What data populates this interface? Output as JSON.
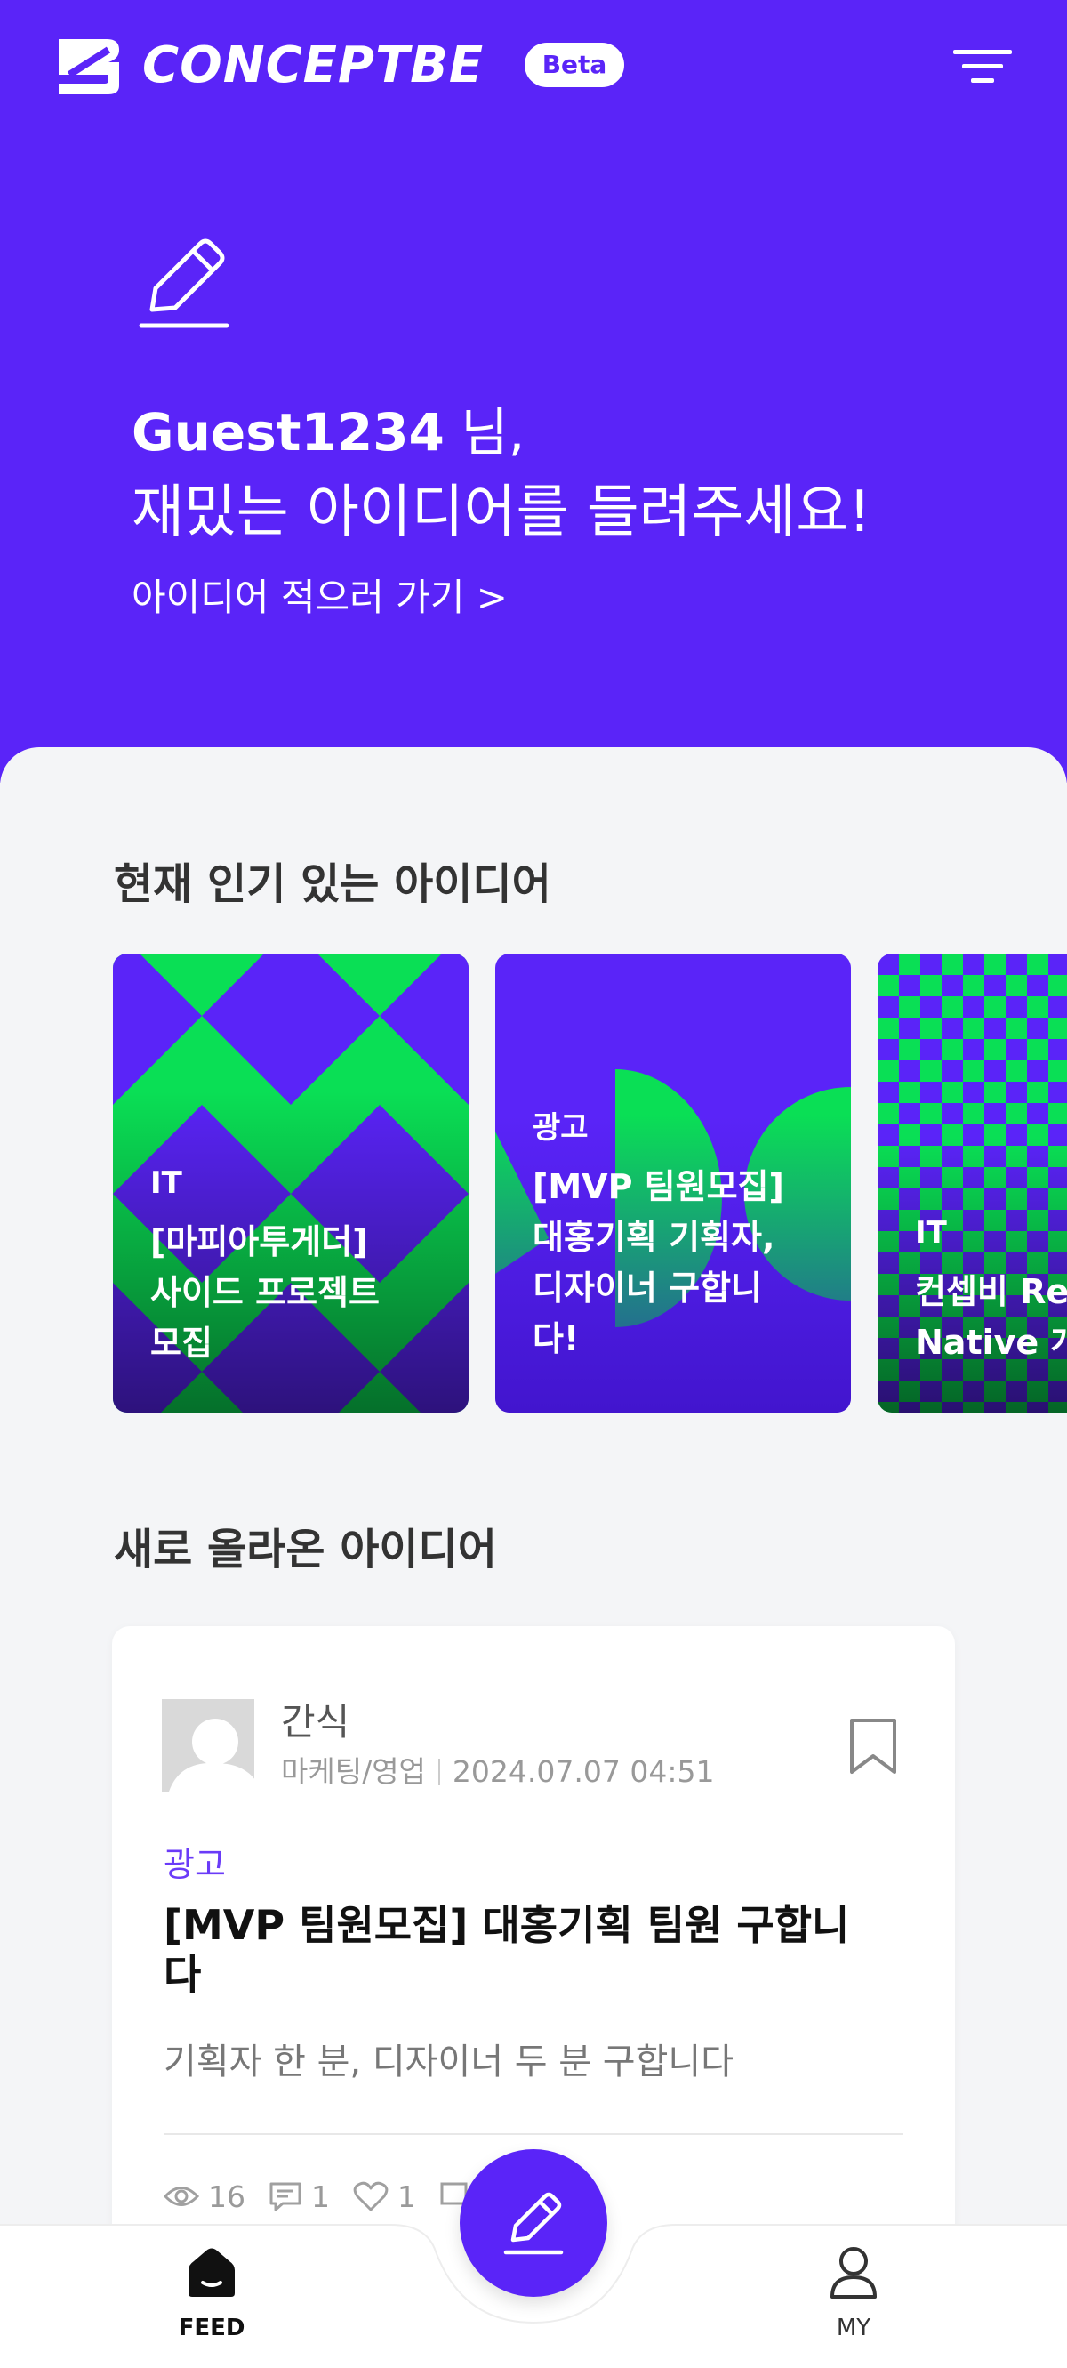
{
  "header": {
    "brand_name": "CONCEPTBE",
    "beta_badge": "Beta",
    "icons": {
      "logo": "brand-logo-icon",
      "menu": "filter-menu-icon"
    }
  },
  "hero": {
    "icon": "pencil-icon",
    "username": "Guest1234",
    "honorific": " 님,",
    "subtitle": "재밌는 아이디어를 들려주세요!",
    "link_text": "아이디어 적으러 가기 >"
  },
  "popular": {
    "title": "현재 인기 있는 아이디어",
    "cards": [
      {
        "category": "IT",
        "title": "[마피아투게더]\n사이드 프로젝트\n모집",
        "pattern": "diamond"
      },
      {
        "category": "광고",
        "title": "[MVP 팀원모집]\n대홍기획 기획자,\n디자이너 구합니\n다!",
        "pattern": "semicircle"
      },
      {
        "category": "IT",
        "title": "컨셉비 Re\nNative 개",
        "pattern": "checker"
      }
    ]
  },
  "new_ideas": {
    "title": "새로 올라온 아이디어",
    "post": {
      "author": "간식",
      "department": "마케팅/영업",
      "datetime": "2024.07.07 04:51",
      "category": "광고",
      "title": "[MVP 팀원모집] 대홍기획 팀원 구합니\n다",
      "body": "기획자 한 분, 디자이너 두 분 구합니다",
      "views": "16",
      "comments": "1",
      "likes": "1"
    }
  },
  "bottom_nav": {
    "feed_label": "FEED",
    "my_label": "MY",
    "icons": {
      "feed": "home-icon",
      "write": "pencil-icon",
      "my": "profile-icon"
    }
  },
  "colors": {
    "brand": "#5A24F8",
    "green": "#0ADF55",
    "background": "#F4F5F7",
    "category_text": "#6A3BF8"
  }
}
